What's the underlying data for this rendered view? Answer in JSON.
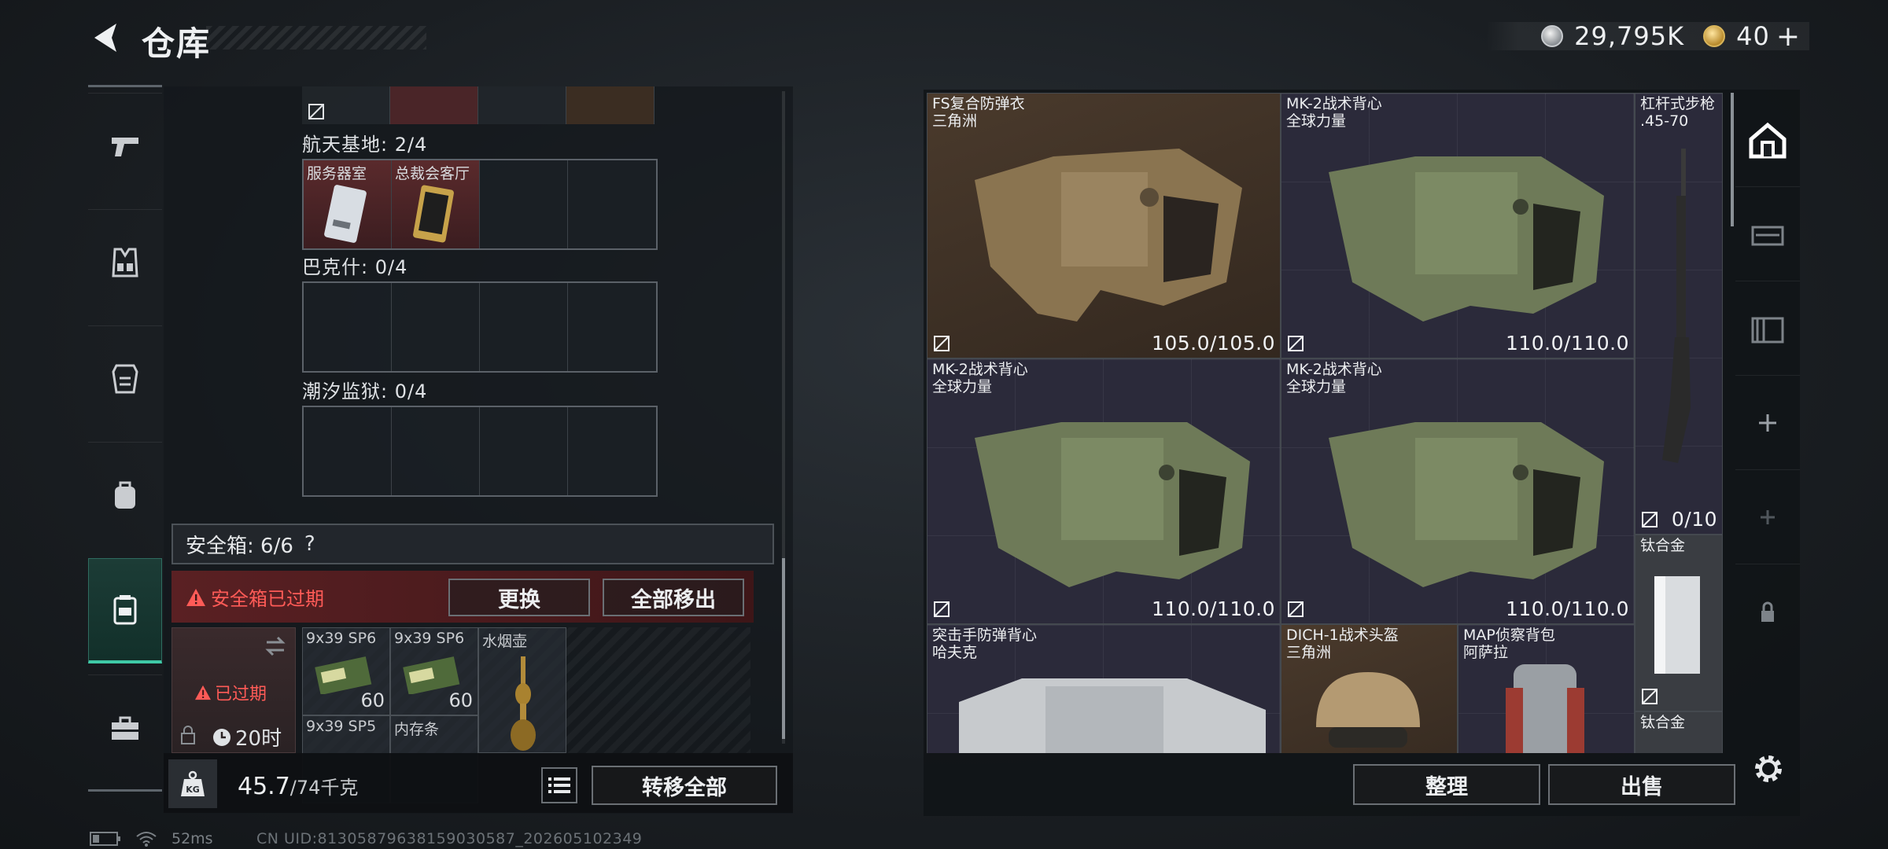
{
  "header": {
    "title": "仓库"
  },
  "currency": {
    "silver_value": "29,795K",
    "gold_value": "40",
    "plus": "+"
  },
  "storage": {
    "areas": [
      {
        "label": "航天基地: 2/4",
        "items": [
          "服务器室",
          "总裁会客厅"
        ]
      },
      {
        "label": "巴克什: 0/4"
      },
      {
        "label": "潮汐监狱: 0/4"
      }
    ]
  },
  "safebox": {
    "title": "安全箱: 6/6",
    "help": "?",
    "expired_warning": "安全箱已过期",
    "replace_label": "更换",
    "remove_all_label": "全部移出",
    "expired_badge": "已过期",
    "timer": "20时",
    "items": [
      {
        "name": "9x39 SP6",
        "qty": "60"
      },
      {
        "name": "9x39 SP6",
        "qty": "60"
      },
      {
        "name": "水烟壶",
        "qty": ""
      },
      {
        "name": "9x39 SP5",
        "qty": ""
      },
      {
        "name": "内存条",
        "qty": ""
      }
    ]
  },
  "footer_left": {
    "weight": "45.7",
    "max": "/74千克",
    "kg": "KG",
    "transfer_all": "转移全部"
  },
  "warehouse": {
    "items": [
      {
        "name": "FS复合防弹衣",
        "sub": "三角洲",
        "durability": "105.0/105.0"
      },
      {
        "name": "MK-2战术背心",
        "sub": "全球力量",
        "durability": "110.0/110.0"
      },
      {
        "name": "杠杆式步枪",
        "sub": ".45-70",
        "durability": "0/10"
      },
      {
        "name": "MK-2战术背心",
        "sub": "全球力量",
        "durability": "110.0/110.0"
      },
      {
        "name": "MK-2战术背心",
        "sub": "全球力量",
        "durability": "110.0/110.0"
      },
      {
        "name": "钛合金",
        "sub": "",
        "durability": ""
      },
      {
        "name": "突击手防弹背心",
        "sub": "哈夫克",
        "durability": ""
      },
      {
        "name": "DICH-1战术头盔",
        "sub": "三角洲",
        "durability": ""
      },
      {
        "name": "MAP侦察背包",
        "sub": "阿萨拉",
        "durability": ""
      },
      {
        "name": "钛合金",
        "sub": "",
        "durability": ""
      }
    ],
    "organize_label": "整理",
    "sell_label": "出售"
  },
  "status_bar": {
    "ping": "52ms",
    "uid": "CN UID:81305879638159030587_202605102349"
  },
  "colors": {
    "accent": "#3fc9a6",
    "danger": "#ff5b57",
    "rare_red": "#5a2a2c",
    "epic_purple": "#2b2a3a"
  }
}
